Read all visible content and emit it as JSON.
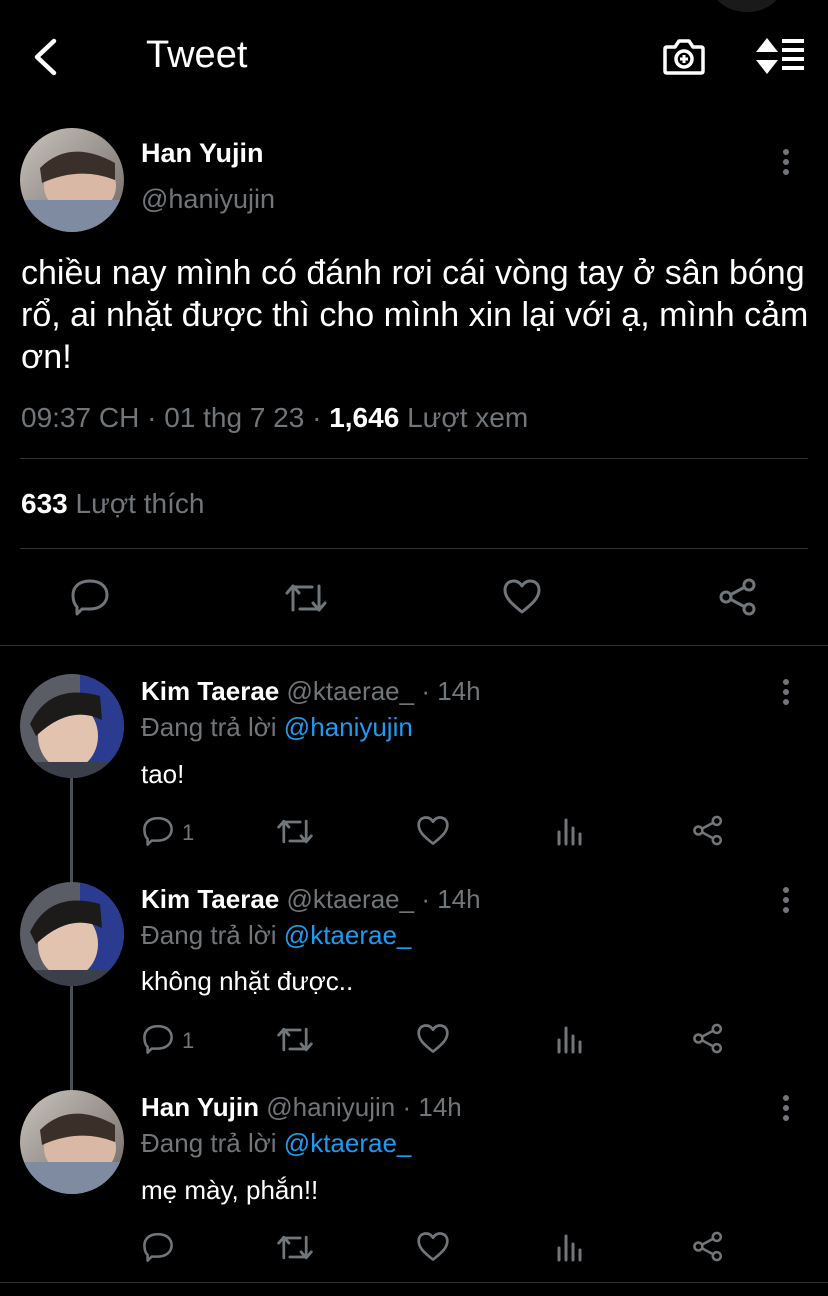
{
  "header": {
    "title": "Tweet"
  },
  "tweet": {
    "name": "Han Yujin",
    "handle": "@haniyujin",
    "text": "chiều nay mình có đánh rơi cái vòng tay ở sân bóng rổ, ai nhặt được thì cho mình xin lại với ạ, mình cảm ơn!",
    "time": "09:37 CH",
    "date": "01 thg 7 23",
    "views_count": "1,646",
    "views_label": "Lượt xem",
    "likes_count": "633",
    "likes_label": "Lượt thích"
  },
  "replies": [
    {
      "name": "Kim Taerae",
      "handle": "@ktaerae_",
      "time": "14h",
      "replying_label": "Đang trả lời",
      "replying_to": "@haniyujin",
      "text": "tao!",
      "reply_count": "1"
    },
    {
      "name": "Kim Taerae",
      "handle": "@ktaerae_",
      "time": "14h",
      "replying_label": "Đang trả lời",
      "replying_to": "@ktaerae_",
      "text": "không nhặt được..",
      "reply_count": "1"
    },
    {
      "name": "Han Yujin",
      "handle": "@haniyujin",
      "time": "14h",
      "replying_label": "Đang trả lời",
      "replying_to": "@ktaerae_",
      "text": "mẹ mày, phắn!!",
      "reply_count": ""
    }
  ],
  "colors": {
    "background": "#000000",
    "text": "#e7e9ea",
    "muted": "#71767b",
    "link": "#1d9bf0",
    "divider": "#2f3336"
  },
  "icons": [
    "back-icon",
    "camera-icon",
    "sort-icon",
    "more-icon",
    "reply-icon",
    "retweet-icon",
    "like-icon",
    "analytics-icon",
    "share-icon"
  ]
}
